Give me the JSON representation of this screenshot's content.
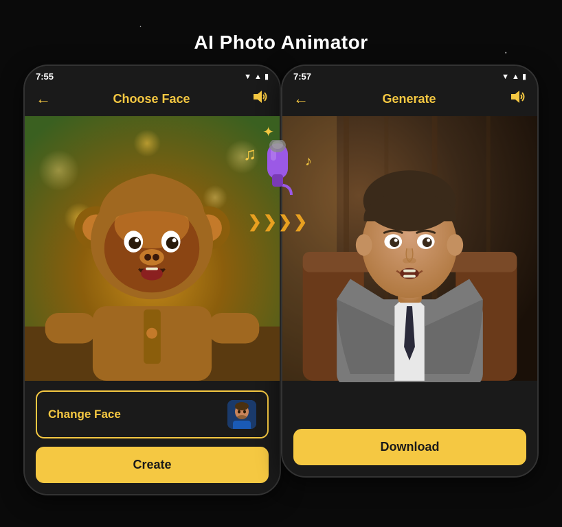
{
  "page": {
    "title": "AI Photo Animator"
  },
  "phone_left": {
    "status_time": "7:55",
    "nav_title": "Choose Face",
    "change_face_label": "Change Face",
    "create_label": "Create"
  },
  "phone_right": {
    "status_time": "7:57",
    "nav_title": "Generate",
    "download_label": "Download"
  },
  "icons": {
    "back_arrow": "←",
    "sound": "🔊",
    "music1": "♫",
    "music2": "♪",
    "chevron": "❯"
  },
  "colors": {
    "gold": "#f5c842",
    "bg": "#0a0a0a",
    "phone_bg": "#1a1a1a",
    "button_text": "#1a1a1a"
  }
}
